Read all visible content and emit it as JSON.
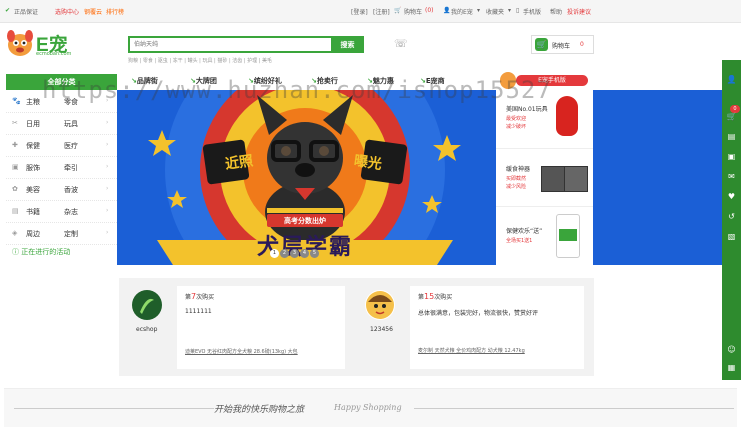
{
  "topbar": {
    "left": [
      "正品保证",
      "选购中心",
      "钢覆云",
      "排行榜"
    ],
    "login": "[登录]",
    "register": "[注册]",
    "cart": "购物车",
    "cart_count": "(0)",
    "my_account": "我的E宠",
    "favorites": "收藏夹",
    "mobile": "手机版",
    "help": "帮助",
    "complaint": "投诉建议"
  },
  "header": {
    "logo_text": "E宠",
    "logo_domain": "ecmoban.com",
    "search_placeholder": "伯纳天纯",
    "search_button": "搜索",
    "hotwords": [
      "狗粮",
      "零食",
      "驱虫",
      "冻干",
      "罐头",
      "玩具",
      "猫砂",
      "洁齿",
      "护理",
      "美毛",
      "宠物窝",
      "自然"
    ],
    "phone": "",
    "cart_label": "购物车",
    "cart_count": "0"
  },
  "nav": {
    "all_categories": "全部分类",
    "items": [
      "品牌街",
      "大牌团",
      "缤纷好礼",
      "抢卖行",
      "魅力惠",
      "E宠商"
    ]
  },
  "categories": [
    {
      "icon": "dog-icon",
      "a": "主粮",
      "b": "零食"
    },
    {
      "icon": "bowl-icon",
      "a": "日用",
      "b": "玩具"
    },
    {
      "icon": "health-icon",
      "a": "保健",
      "b": "医疗"
    },
    {
      "icon": "shirt-icon",
      "a": "服饰",
      "b": "牵引"
    },
    {
      "icon": "comb-icon",
      "a": "美容",
      "b": "香波"
    },
    {
      "icon": "book-icon",
      "a": "书籍",
      "b": "杂志"
    },
    {
      "icon": "map-icon",
      "a": "周边",
      "b": "定制"
    }
  ],
  "events_link": "正在进行的活动",
  "banner": {
    "left_word": "近照",
    "right_word": "曝光",
    "ribbon": "高考分数出炉",
    "headline": "犬层学霸",
    "dots": [
      "1",
      "2",
      "3",
      "4",
      "5"
    ]
  },
  "watermark": "https://www.huzhan.com/ishop15527",
  "mobile_badge": "E宠手机版",
  "side_ads": [
    {
      "title": "美国No.01玩具",
      "sub1": "最受欢迎",
      "sub2": "减少破坏"
    },
    {
      "title": "缓食神器",
      "sub1": "买即截然",
      "sub2": "减少风险"
    },
    {
      "title": "保健欢乐“送”",
      "sub1": "全场买1送1",
      "sub2": ""
    }
  ],
  "reviews": [
    {
      "prefix": "第",
      "num": "7",
      "suffix": "次购买",
      "text": "1111111",
      "user": "ecshop",
      "product": "迪莱EVO 无谷红肉配方全犬粮 28.6磅(13kg) 大包"
    },
    {
      "prefix": "第",
      "num": "15",
      "suffix": "次购买",
      "text": "总体很满意，包装完好，物流很快，赞赏好评",
      "user": "123456",
      "product": "麦尔制 天然犬粮 全价鸡肉配方 幼犬粮 12.47kg"
    }
  ],
  "slogan": "开始我的快乐购物之旅",
  "slogan_en": "Happy Shopping",
  "right_sidebar": {
    "cart_count": "0",
    "items": [
      "user-icon",
      "cart-icon",
      "list-icon",
      "wallet-icon",
      "chat-icon",
      "heart-icon",
      "history-icon",
      "coupon-icon"
    ],
    "bottom": [
      "service-icon",
      "qrcode-icon"
    ]
  },
  "colors": {
    "brand_green": "#3aa53b",
    "banner_blue": "#1b5fd6",
    "accent_red": "#e4393c",
    "accent_orange": "#ff6600",
    "sidebar_green": "#2e8b2e"
  }
}
